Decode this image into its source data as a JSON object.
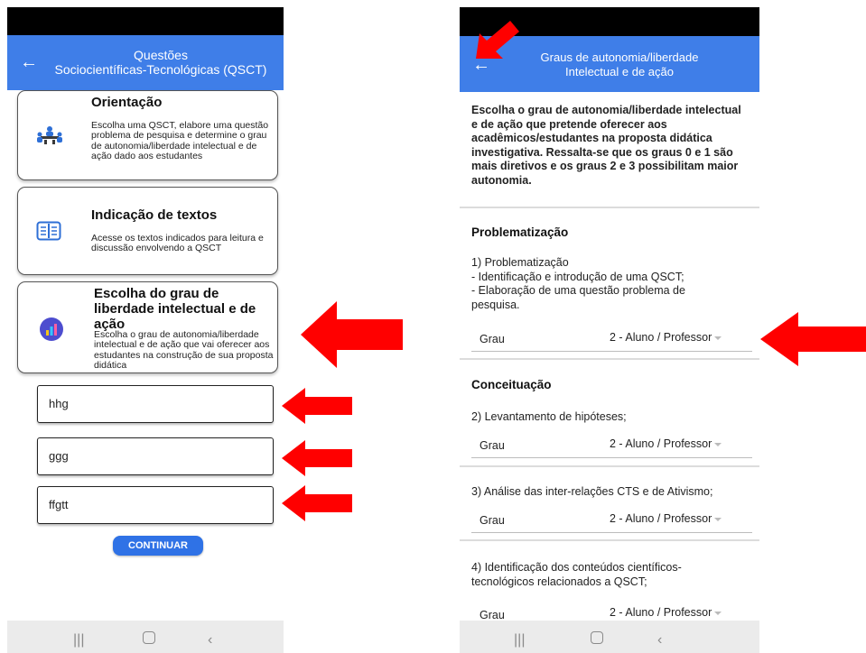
{
  "left": {
    "header_title_line1": "Questões",
    "header_title_line2": "Sociocientíficas-Tecnológicas (QSCT)",
    "cards": [
      {
        "title": "Orientação",
        "text": "Escolha uma QSCT, elabore uma questão problema de pesquisa e determine o grau de autonomia/liberdade intelectual e de ação dado aos estudantes",
        "icon": "people-meeting-icon"
      },
      {
        "title": "Indicação de textos",
        "text": "Acesse os textos indicados para leitura e discussão envolvendo a QSCT",
        "icon": "book-icon"
      },
      {
        "title": "Escolha do grau de liberdade intelectual e de ação",
        "text": "Escolha o grau de autonomia/liberdade intelectual e de ação que vai oferecer aos estudantes na construção de sua proposta didática",
        "icon": "bar-chart-icon"
      }
    ],
    "fields": [
      "hhg",
      "ggg",
      "ffgtt"
    ],
    "continue_label": "CONTINUAR"
  },
  "right": {
    "header_title_line1": "Graus de autonomia/liberdade",
    "header_title_line2": "Intelectual e de ação",
    "intro": "Escolha o grau de autonomia/liberdade intelectual e de ação que pretende oferecer aos acadêmicos/estudantes na proposta didática investigativa. Ressalta-se que os graus 0 e 1 são mais diretivos e os graus 2 e 3 possibilitam maior autonomia.",
    "section1_title": "Problematização",
    "item1_l1": "1) Problematização",
    "item1_l2": "- Identificação e introdução de uma QSCT;",
    "item1_l3": "- Elaboração de uma questão problema de",
    "item1_l4": "pesquisa.",
    "section2_title": "Conceituação",
    "item2": "2) Levantamento de hipóteses;",
    "item3": "3) Análise das inter-relações CTS e de Ativismo;",
    "item4_l1": "4) Identificação dos conteúdos científicos-",
    "item4_l2": "tecnológicos relacionados a QSCT;",
    "grau_label": "Grau",
    "grau_value": "2 - Aluno / Professor"
  },
  "colors": {
    "appbar": "#3f7ee8",
    "arrow": "#ff0000",
    "button": "#2f72e6"
  }
}
